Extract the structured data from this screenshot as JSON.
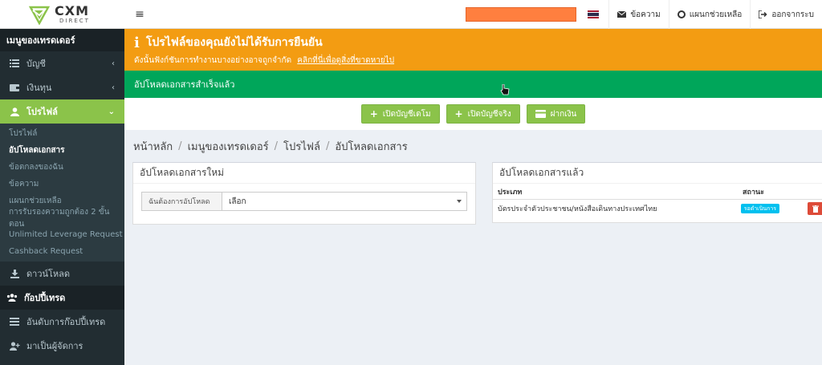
{
  "brand": {
    "name": "CXM",
    "tagline": "DIRECT"
  },
  "sidebar": {
    "header": "เมนูของเทรดเดอร์",
    "items": [
      {
        "label": "บัญชี",
        "icon": "list-icon"
      },
      {
        "label": "เงินทุน",
        "icon": "wallet-icon"
      },
      {
        "label": "โปรไฟล์",
        "icon": "user-icon"
      }
    ],
    "profile_submenu": [
      "โปรไฟล์",
      "อัปโหลดเอกสาร",
      "ข้อตกลงของฉัน",
      "ข้อความ",
      "แผนกช่วยเหลือ",
      "การรับรองความถูกต้อง 2 ขั้นตอน",
      "Unlimited Leverage Request",
      "Cashback Request"
    ],
    "download_label": "ดาวน์โหลด",
    "copytrade_header": "ก๊อปปี้เทรด",
    "copytrade_items": [
      "อันดับการก๊อปปี้เทรด",
      "มาเป็นผู้จัดการ"
    ]
  },
  "navbar": {
    "messages_label": "ข้อความ",
    "support_label": "แผนกช่วยเหลือ",
    "logout_label": "ออกจากระบ"
  },
  "alert_warning": {
    "title": "โปรไฟล์ของคุณยังไม่ได้รับการยืนยัน",
    "message": "ดังนั้นฟังก์ชันการทำงานบางอย่างอาจถูกจำกัด",
    "link": "คลิกที่นี่เพื่อดูสิ่งที่ขาดหายไป"
  },
  "alert_success": {
    "message": "อัปโหลดเอกสารสำเร็จแล้ว"
  },
  "actions": {
    "demo_account": "เปิดบัญชีเดโม",
    "real_account": "เปิดบัญชีจริง",
    "deposit": "ฝากเงิน"
  },
  "breadcrumb": [
    "หน้าหลัก",
    "เมนูของเทรดเดอร์",
    "โปรไฟล์",
    "อัปโหลดเอกสาร"
  ],
  "upload_new": {
    "title": "อัปโหลดเอกสารใหม่",
    "field_label": "ฉันต้องการอัปโหลด",
    "field_value": "เลือก"
  },
  "uploaded": {
    "title": "อัปโหลดเอกสารแล้ว",
    "col_type": "ประเภท",
    "col_status": "สถานะ",
    "rows": [
      {
        "type": "บัตรประจำตัวประชาชน/หนังสือเดินทางประเทศไทย",
        "status": "รอดำเนินการ"
      }
    ]
  },
  "colors": {
    "sidebar_bg": "#222d32",
    "accent_green": "#8bc34a",
    "warning": "#f39c12",
    "success": "#00a65a",
    "badge": "#00c0ef",
    "danger": "#dd4b39",
    "redacted": "#ff7f3f"
  }
}
